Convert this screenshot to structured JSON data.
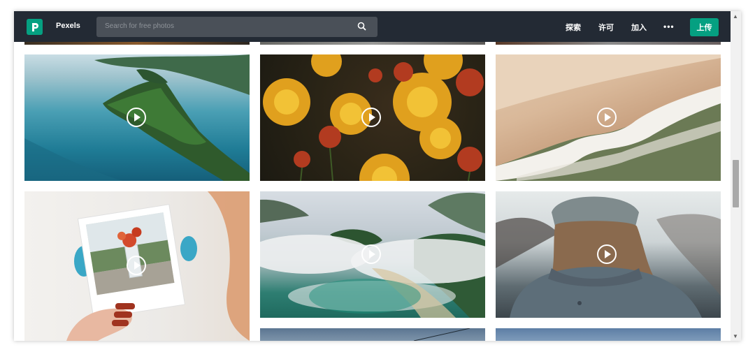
{
  "header": {
    "brand": "Pexels",
    "search_placeholder": "Search for free photos",
    "nav": [
      "探索",
      "许可",
      "加入"
    ],
    "upload_label": "上传"
  },
  "colors": {
    "navbar": "#232a34",
    "accent": "#05a081"
  },
  "videos": [
    {
      "subject": "aerial island lake"
    },
    {
      "subject": "orange chrysanthemum flowers"
    },
    {
      "subject": "beach waves aerial"
    },
    {
      "subject": "hand holding polaroid photo"
    },
    {
      "subject": "foggy coastal island aerial"
    },
    {
      "subject": "person in beanie from behind"
    }
  ]
}
